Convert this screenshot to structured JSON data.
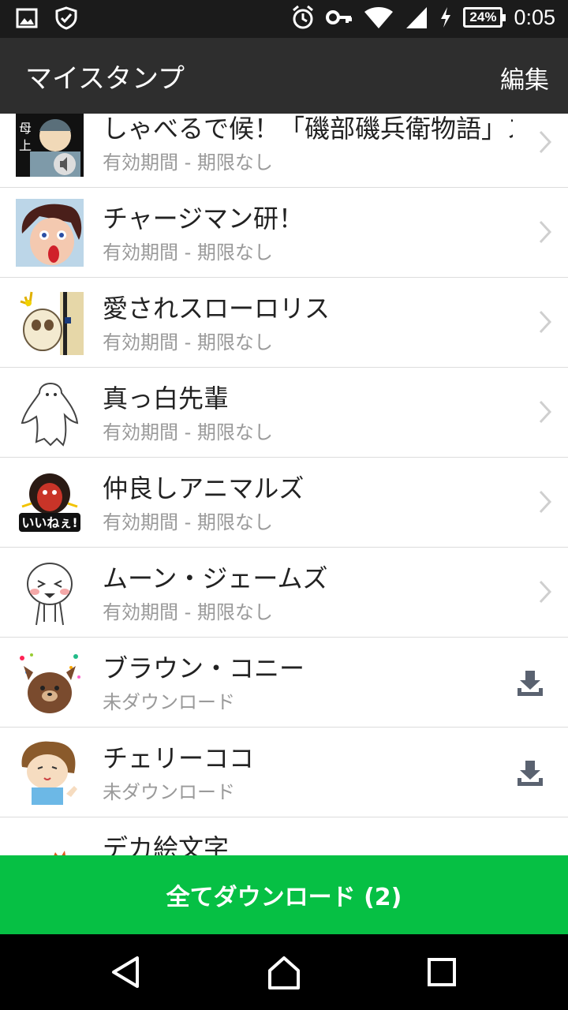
{
  "status_bar": {
    "icons_left": [
      "image-icon",
      "shield-icon"
    ],
    "icons_right": [
      "alarm-icon",
      "key-icon",
      "wifi-icon",
      "cell-signal-icon",
      "charging-icon"
    ],
    "battery": "24%",
    "time": "0:05"
  },
  "app_bar": {
    "title": "マイスタンプ",
    "edit_label": "編集"
  },
  "stickers": [
    {
      "title": "しゃべるで候！「磯部磯兵衛物語」スタ...",
      "status": "有効期間 - 期限なし",
      "action": "chevron"
    },
    {
      "title": "チャージマン研！",
      "status": "有効期間 - 期限なし",
      "action": "chevron"
    },
    {
      "title": "愛されスローロリス",
      "status": "有効期間 - 期限なし",
      "action": "chevron"
    },
    {
      "title": "真っ白先輩",
      "status": "有効期間 - 期限なし",
      "action": "chevron"
    },
    {
      "title": "仲良しアニマルズ",
      "status": "有効期間 - 期限なし",
      "action": "chevron"
    },
    {
      "title": "ムーン・ジェームズ",
      "status": "有効期間 - 期限なし",
      "action": "chevron"
    },
    {
      "title": "ブラウン・コニー",
      "status": "未ダウンロード",
      "action": "download"
    },
    {
      "title": "チェリーココ",
      "status": "未ダウンロード",
      "action": "download"
    },
    {
      "title": "デカ絵文字",
      "status": "",
      "action": "none"
    }
  ],
  "download_all_label": "全てダウンロード (2)",
  "nav_bar": {
    "icons": [
      "back-icon",
      "home-icon",
      "recents-icon"
    ]
  },
  "colors": {
    "accent_green": "#06c044",
    "app_bar": "#2e2e2e",
    "status_bar": "#1b1b1b"
  }
}
